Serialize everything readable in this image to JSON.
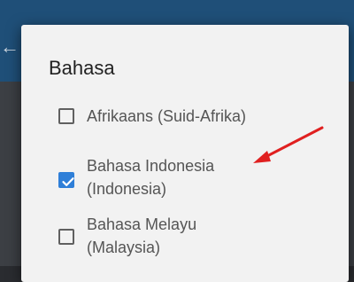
{
  "dialog": {
    "title": "Bahasa",
    "options": [
      {
        "label": "Afrikaans (Suid-Afrika)",
        "checked": false
      },
      {
        "label_line1": "Bahasa Indonesia",
        "label_line2": "(Indonesia)",
        "checked": true
      },
      {
        "label_line1": "Bahasa Melayu",
        "label_line2": "(Malaysia)",
        "checked": false
      }
    ]
  },
  "colors": {
    "accent": "#2f7fd8",
    "annotation_arrow": "#e02020",
    "dialog_background": "#f2f2f2"
  },
  "icons": {
    "back": "arrow-left-icon",
    "checkmark": "check-icon",
    "annotation": "red-arrow-icon"
  }
}
